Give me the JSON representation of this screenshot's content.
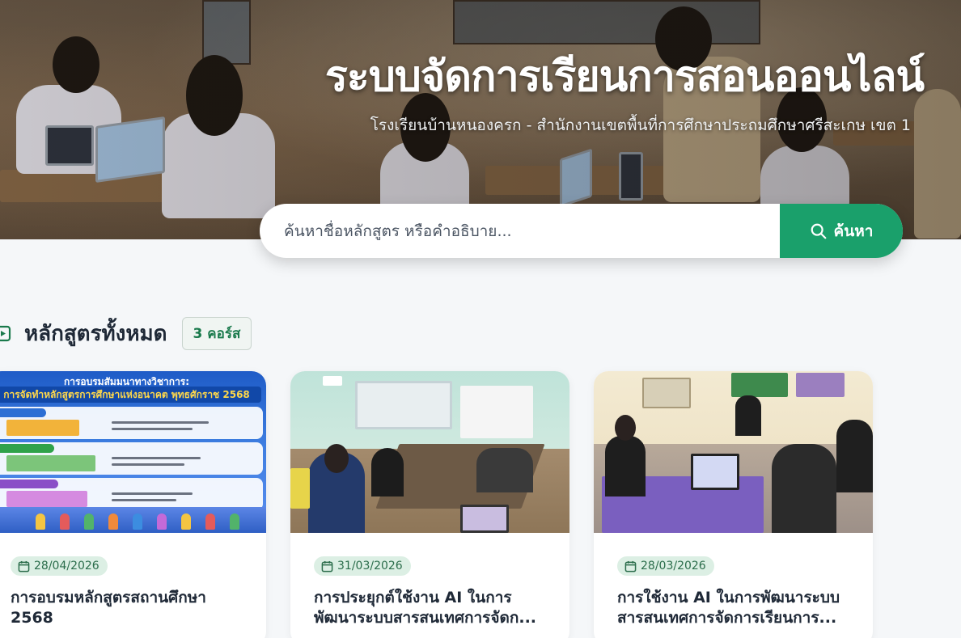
{
  "hero": {
    "title": "ระบบจัดการเรียนการสอนออนไลน์",
    "subtitle": "โรงเรียนบ้านหนองครก - สำนักงานเขตพื้นที่การศึกษาประถมศึกษาศรีสะเกษ เขต 1"
  },
  "search": {
    "placeholder": "ค้นหาชื่อหลักสูตร หรือคำอธิบาย...",
    "button_label": "ค้นหา"
  },
  "section": {
    "title": "หลักสูตรทั้งหมด",
    "count_badge": "3 คอร์ส"
  },
  "courses": [
    {
      "date": "28/04/2026",
      "title": "การอบรมหลักสูตรสถานศึกษา 2568",
      "thumb": {
        "heading": "การอบรมสัมมนาทางวิชาการ:",
        "banner": "การจัดทำหลักสูตรการศึกษาแห่งอนาคต พุทธศักราช 2568"
      }
    },
    {
      "date": "31/03/2026",
      "title": "การประยุกต์ใช้งาน AI ในการพัฒนาระบบสารสนเทศการจัดก..."
    },
    {
      "date": "28/03/2026",
      "title": "การใช้งาน AI ในการพัฒนาระบบสารสนเทศการจัดการเรียนการ..."
    }
  ],
  "colors": {
    "accent": "#1aa06b",
    "badge_text": "#1a7a4c",
    "chip_bg": "#dcefe4"
  },
  "icons": {
    "search_button": "search-icon",
    "section": "course-list-icon",
    "date": "calendar-icon"
  }
}
